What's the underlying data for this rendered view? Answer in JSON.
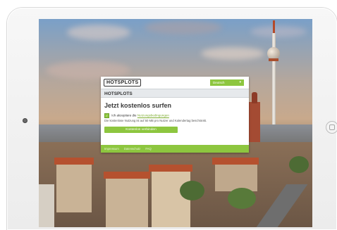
{
  "popup": {
    "logo": "HOTSPLOTS",
    "language": "Deutsch",
    "title": "HOTSPLOTS",
    "headline": "Jetzt kostenlos surfen",
    "terms_prefix": "Ich akzeptiere die",
    "terms_link": "Nutzungsbedingungen",
    "info": "Die kostenlose Nutzung ist auf 50 MB pro Nutzer und Kalendertag beschränkt.",
    "connect_label": "Kostenlos verbinden",
    "footer_links": [
      "Impressum",
      "Datenschutz",
      "FAQ"
    ]
  },
  "colors": {
    "accent": "#8dc63f",
    "title_bar": "#e6e9ec"
  }
}
